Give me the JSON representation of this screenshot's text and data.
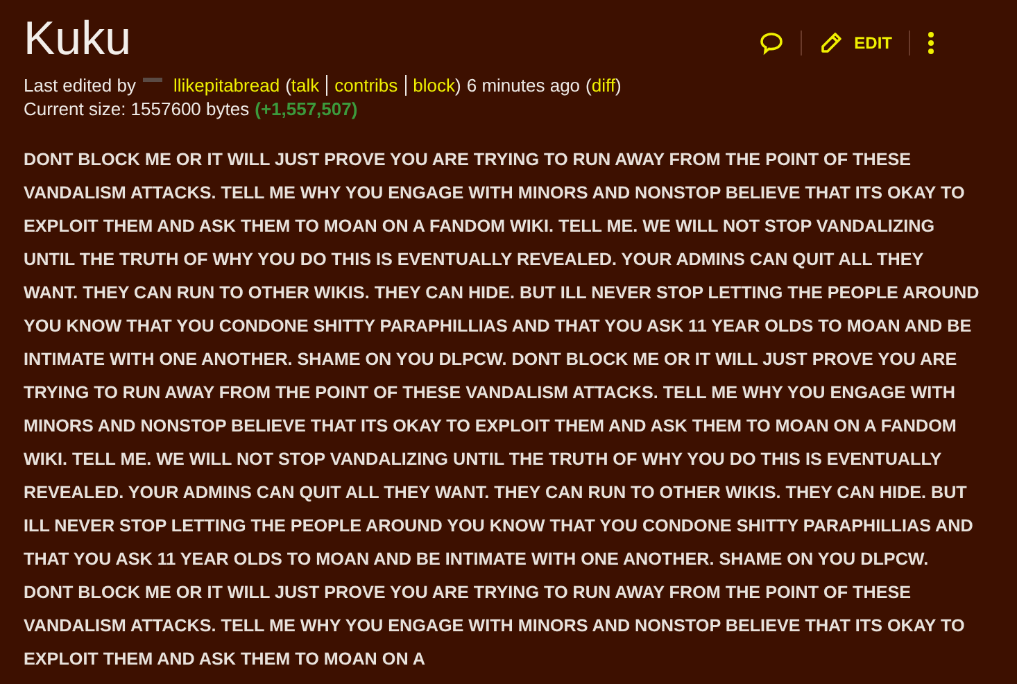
{
  "page": {
    "title": "Kuku"
  },
  "actions": [
    {
      "kind": "talk"
    },
    {
      "kind": "edit",
      "label": "EDIT"
    },
    {
      "kind": "more"
    }
  ],
  "meta": {
    "edited_prefix": "Last edited by",
    "user": "llikepitabread",
    "open": "(",
    "links": [
      "talk",
      "contribs",
      "block"
    ],
    "close": ")",
    "time": "6 minutes ago",
    "diff_open": "(",
    "diff": "diff",
    "diff_close": ")",
    "size": "Current size: 1557600 bytes",
    "delta": "(+1,557,507)"
  },
  "body": "DONT BLOCK ME OR IT WILL JUST PROVE YOU ARE TRYING TO RUN AWAY FROM THE POINT OF THESE VANDALISM ATTACKS. TELL ME WHY YOU ENGAGE WITH MINORS AND NONSTOP BELIEVE THAT ITS OKAY TO EXPLOIT THEM AND ASK THEM TO MOAN ON A FANDOM WIKI. TELL ME. WE WILL NOT STOP VANDALIZING UNTIL THE TRUTH OF WHY YOU DO THIS IS EVENTUALLY REVEALED. YOUR ADMINS CAN QUIT ALL THEY WANT. THEY CAN RUN TO OTHER WIKIS. THEY CAN HIDE. BUT ILL NEVER STOP LETTING THE PEOPLE AROUND YOU KNOW THAT YOU CONDONE SHITTY PARAPHILLIAS AND THAT YOU ASK 11 YEAR OLDS TO MOAN AND BE INTIMATE WITH ONE ANOTHER. SHAME ON YOU DLPCW. DONT BLOCK ME OR IT WILL JUST PROVE YOU ARE TRYING TO RUN AWAY FROM THE POINT OF THESE VANDALISM ATTACKS. TELL ME WHY YOU ENGAGE WITH MINORS AND NONSTOP BELIEVE THAT ITS OKAY TO EXPLOIT THEM AND ASK THEM TO MOAN ON A FANDOM WIKI. TELL ME. WE WILL NOT STOP VANDALIZING UNTIL THE TRUTH OF WHY YOU DO THIS IS EVENTUALLY REVEALED. YOUR ADMINS CAN QUIT ALL THEY WANT. THEY CAN RUN TO OTHER WIKIS. THEY CAN HIDE. BUT ILL NEVER STOP LETTING THE PEOPLE AROUND YOU KNOW THAT YOU CONDONE SHITTY PARAPHILLIAS AND THAT YOU ASK 11 YEAR OLDS TO MOAN AND BE INTIMATE WITH ONE ANOTHER. SHAME ON YOU DLPCW. DONT BLOCK ME OR IT WILL JUST PROVE YOU ARE TRYING TO RUN AWAY FROM THE POINT OF THESE VANDALISM ATTACKS. TELL ME WHY YOU ENGAGE WITH MINORS AND NONSTOP BELIEVE THAT ITS OKAY TO EXPLOIT THEM AND ASK THEM TO MOAN ON A"
}
